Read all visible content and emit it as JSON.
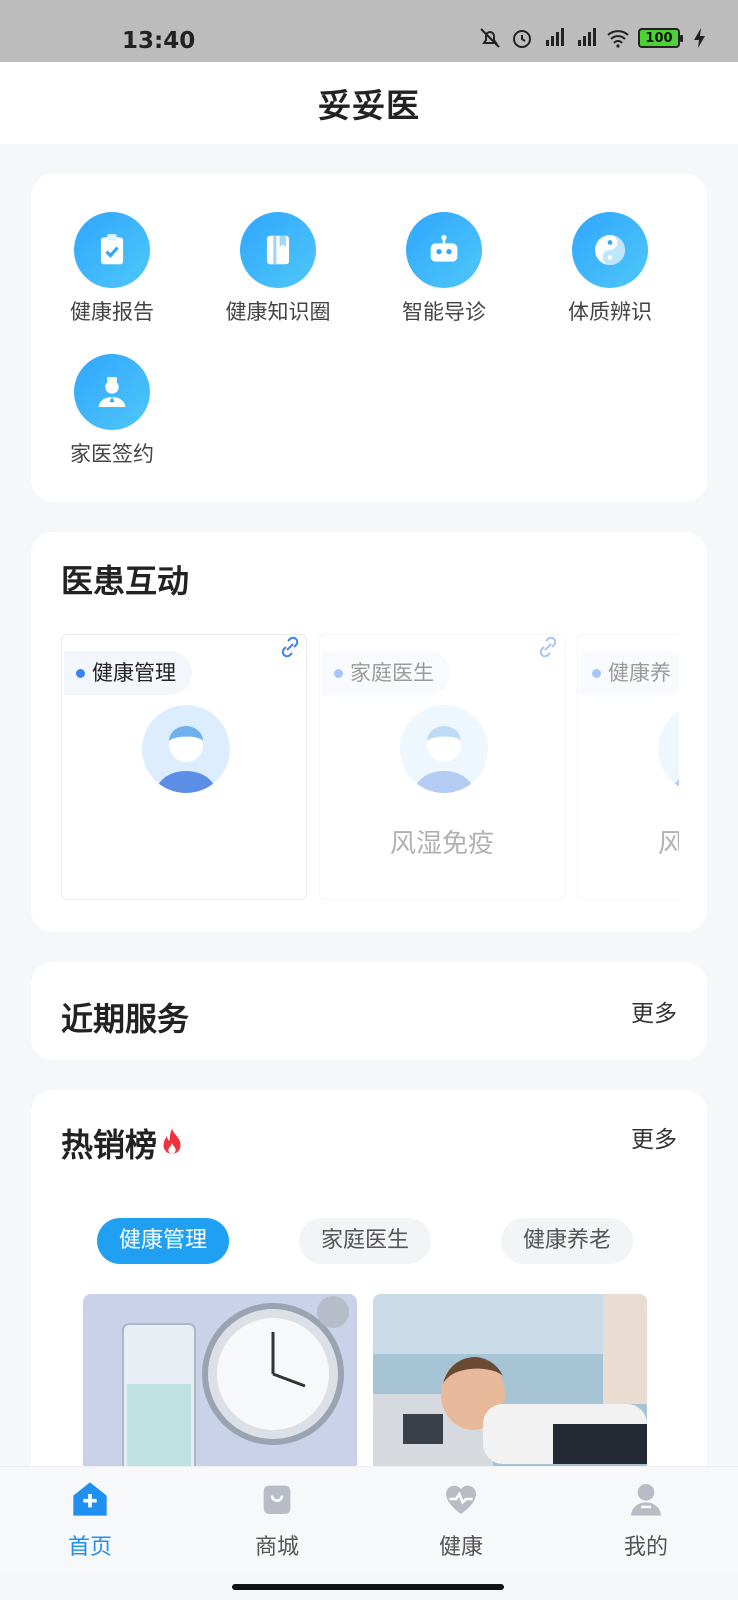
{
  "status_bar": {
    "time": "13:40",
    "battery": "100"
  },
  "header": {
    "title": "妥妥医"
  },
  "quick_actions": [
    {
      "label": "健康报告",
      "icon": "clipboard-check-icon"
    },
    {
      "label": "健康知识圈",
      "icon": "book-icon"
    },
    {
      "label": "智能导诊",
      "icon": "robot-icon"
    },
    {
      "label": "体质辨识",
      "icon": "yin-yang-icon"
    },
    {
      "label": "家医签约",
      "icon": "doctor-icon"
    }
  ],
  "interaction": {
    "title": "医患互动",
    "doctors": [
      {
        "tag": "健康管理",
        "name": ""
      },
      {
        "tag": "家庭医生",
        "name": "风湿免疫"
      },
      {
        "tag": "健康养",
        "name": "风"
      }
    ]
  },
  "recent_services": {
    "title": "近期服务",
    "more": "更多"
  },
  "hot_list": {
    "title": "热销榜",
    "more": "更多",
    "tabs": [
      "健康管理",
      "家庭医生",
      "健康养老"
    ],
    "active_tab": 0
  },
  "bottom_nav": [
    {
      "label": "首页",
      "icon": "home-plus-icon",
      "active": true
    },
    {
      "label": "商城",
      "icon": "shopping-bag-icon",
      "active": false
    },
    {
      "label": "健康",
      "icon": "heart-pulse-icon",
      "active": false
    },
    {
      "label": "我的",
      "icon": "user-icon",
      "active": false
    }
  ],
  "colors": {
    "accent": "#1fa0f2",
    "nav_active": "#1f8ff0",
    "icon_gradient_start": "#2fa6ff",
    "icon_gradient_end": "#4fc7f7"
  }
}
